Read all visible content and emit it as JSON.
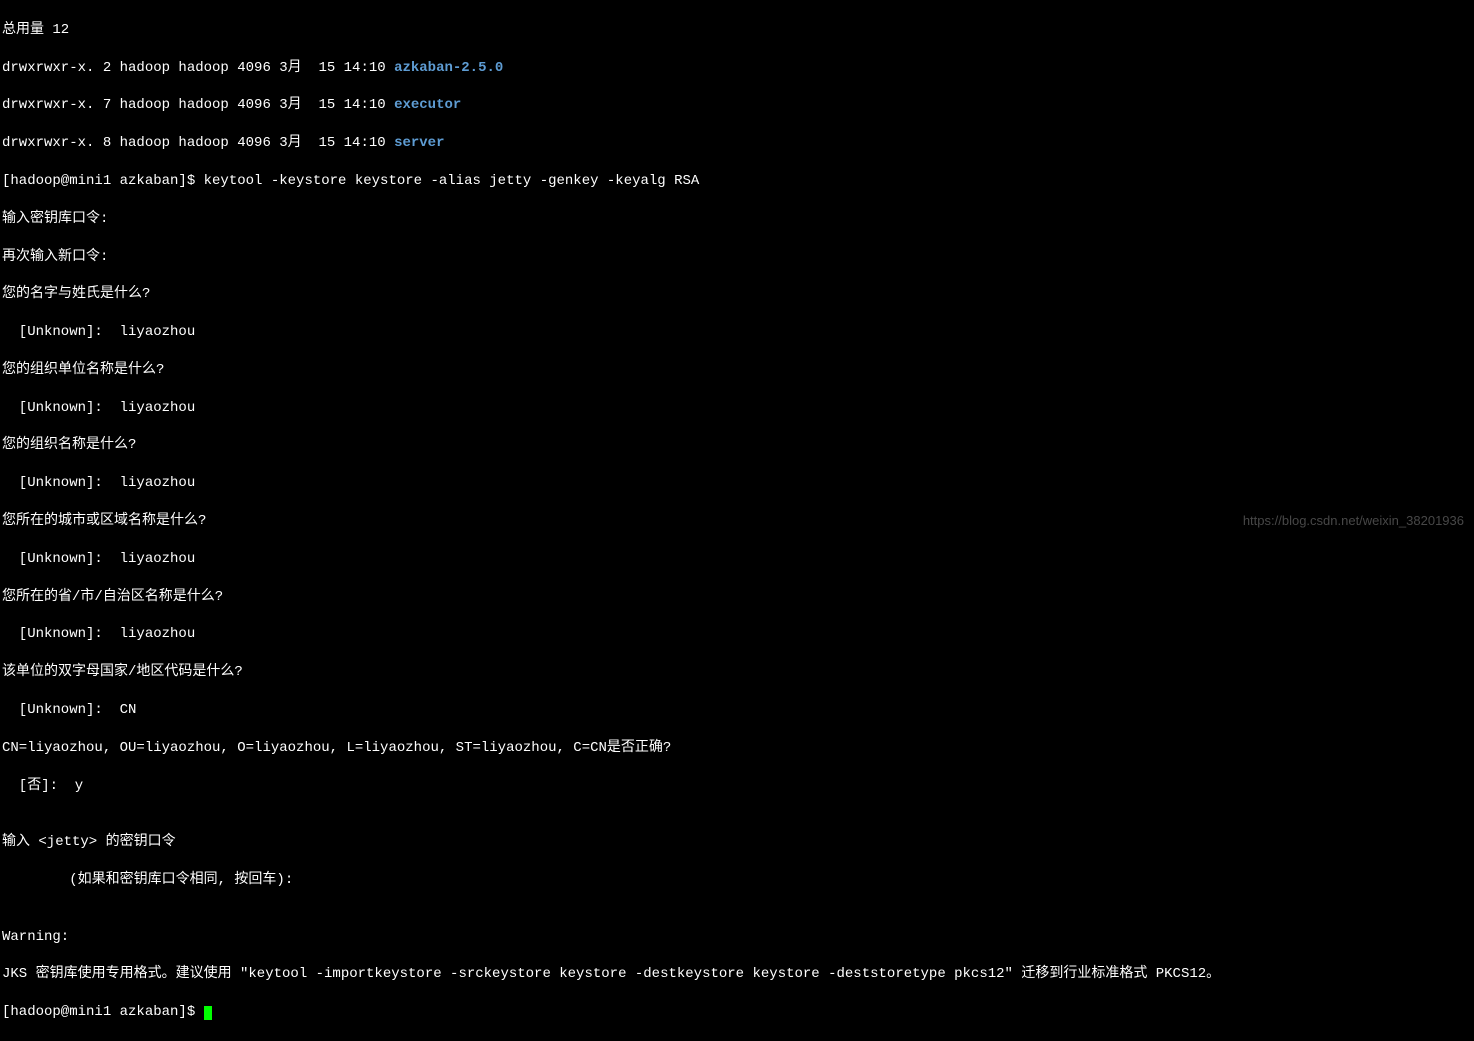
{
  "lines": {
    "total": "总用量 12",
    "ls1_perms": "drwxrwxr-x. 2 hadoop hadoop 4096 3月  15 14:10 ",
    "ls1_name": "azkaban-2.5.0",
    "ls2_perms": "drwxrwxr-x. 7 hadoop hadoop 4096 3月  15 14:10 ",
    "ls2_name": "executor",
    "ls3_perms": "drwxrwxr-x. 8 hadoop hadoop 4096 3月  15 14:10 ",
    "ls3_name": "server",
    "prompt_cmd": "[hadoop@mini1 azkaban]$ keytool -keystore keystore -alias jetty -genkey -keyalg RSA",
    "enter_pass": "输入密钥库口令:  ",
    "reenter_pass": "再次输入新口令: ",
    "q_name": "您的名字与姓氏是什么?",
    "a_name": "  [Unknown]:  liyaozhou",
    "q_ou": "您的组织单位名称是什么?",
    "a_ou": "  [Unknown]:  liyaozhou",
    "q_org": "您的组织名称是什么?",
    "a_org": "  [Unknown]:  liyaozhou",
    "q_city": "您所在的城市或区域名称是什么?",
    "a_city": "  [Unknown]:  liyaozhou",
    "q_state": "您所在的省/市/自治区名称是什么?",
    "a_state": "  [Unknown]:  liyaozhou",
    "q_country": "该单位的双字母国家/地区代码是什么?",
    "a_country": "  [Unknown]:  CN",
    "confirm": "CN=liyaozhou, OU=liyaozhou, O=liyaozhou, L=liyaozhou, ST=liyaozhou, C=CN是否正确?",
    "confirm_answer": "  [否]:  y",
    "blank1": "",
    "jetty_pass": "输入 <jetty> 的密钥口令",
    "jetty_hint": "        (如果和密钥库口令相同, 按回车):  ",
    "blank2": "",
    "warning": "Warning:",
    "jks_warning": "JKS 密钥库使用专用格式。建议使用 \"keytool -importkeystore -srckeystore keystore -destkeystore keystore -deststoretype pkcs12\" 迁移到行业标准格式 PKCS12。",
    "final_prompt": "[hadoop@mini1 azkaban]$ "
  },
  "watermark": "https://blog.csdn.net/weixin_38201936"
}
